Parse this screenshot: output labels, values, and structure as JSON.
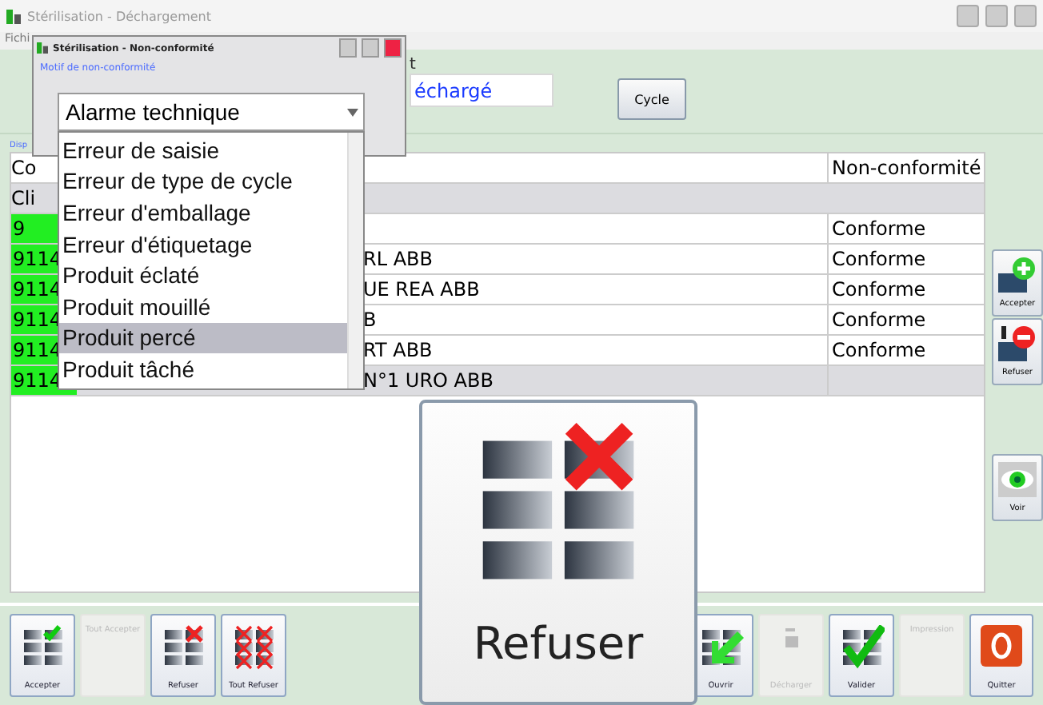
{
  "window": {
    "title": "Stérilisation - Déchargement"
  },
  "menu": [
    "Fichi"
  ],
  "top_panel": {
    "field_label": "t",
    "field_value": "échargé",
    "cycle_button": "Cycle"
  },
  "group_label": "Disp",
  "table": {
    "columns": [
      "Co",
      "Non-conformité"
    ],
    "rows": [
      {
        "kind": "group",
        "code": "Cli",
        "label": "",
        "status": ""
      },
      {
        "kind": "item",
        "code": "9",
        "label": "",
        "status": "Conforme",
        "selected": false
      },
      {
        "kind": "item",
        "code": "9114",
        "label": "RL ABB",
        "status": "Conforme",
        "selected": false
      },
      {
        "kind": "item",
        "code": "9114",
        "label": "UE REA ABB",
        "status": "Conforme",
        "selected": false
      },
      {
        "kind": "item",
        "code": "9114",
        "label": "B",
        "status": "Conforme",
        "selected": false
      },
      {
        "kind": "item",
        "code": "9114",
        "label": "RT ABB",
        "status": "Conforme",
        "selected": false
      },
      {
        "kind": "item",
        "code": "9114",
        "label": "N°1 URO ABB",
        "status": "",
        "selected": true
      }
    ]
  },
  "side_buttons": [
    {
      "kind": "accept",
      "label": "Accepter"
    },
    {
      "kind": "refuse",
      "label": "Refuser"
    },
    {
      "kind": "view",
      "label": "Voir"
    }
  ],
  "toolbar_left": [
    {
      "kind": "accept",
      "label": "Accepter",
      "disabled": false
    },
    {
      "kind": "accept-all",
      "label": "Tout Accepter",
      "disabled": true
    },
    {
      "kind": "refuse",
      "label": "Refuser",
      "disabled": false
    },
    {
      "kind": "refuse-all",
      "label": "Tout Refuser",
      "disabled": false
    }
  ],
  "toolbar_right": [
    {
      "kind": "open",
      "label": "Ouvrir",
      "disabled": false
    },
    {
      "kind": "unload",
      "label": "Décharger",
      "disabled": true
    },
    {
      "kind": "validate",
      "label": "Valider",
      "disabled": false
    },
    {
      "kind": "print",
      "label": "Impression",
      "disabled": true
    },
    {
      "kind": "quit",
      "label": "Quitter",
      "disabled": false
    }
  ],
  "dialog": {
    "title": "Stérilisation - Non-conformité",
    "group_label": "Motif de non-conformité",
    "combo_value": "Alarme technique",
    "options": [
      {
        "label": "Erreur de saisie",
        "selected": false
      },
      {
        "label": "Erreur de type de cycle",
        "selected": false
      },
      {
        "label": "Erreur d'emballage",
        "selected": false
      },
      {
        "label": "Erreur d'étiquetage",
        "selected": false
      },
      {
        "label": "Produit éclaté",
        "selected": false
      },
      {
        "label": "Produit mouillé",
        "selected": false
      },
      {
        "label": "Produit percé",
        "selected": true
      },
      {
        "label": "Produit tâché",
        "selected": false
      }
    ]
  },
  "tooltip": {
    "kind": "refuse",
    "label": "Refuser"
  }
}
